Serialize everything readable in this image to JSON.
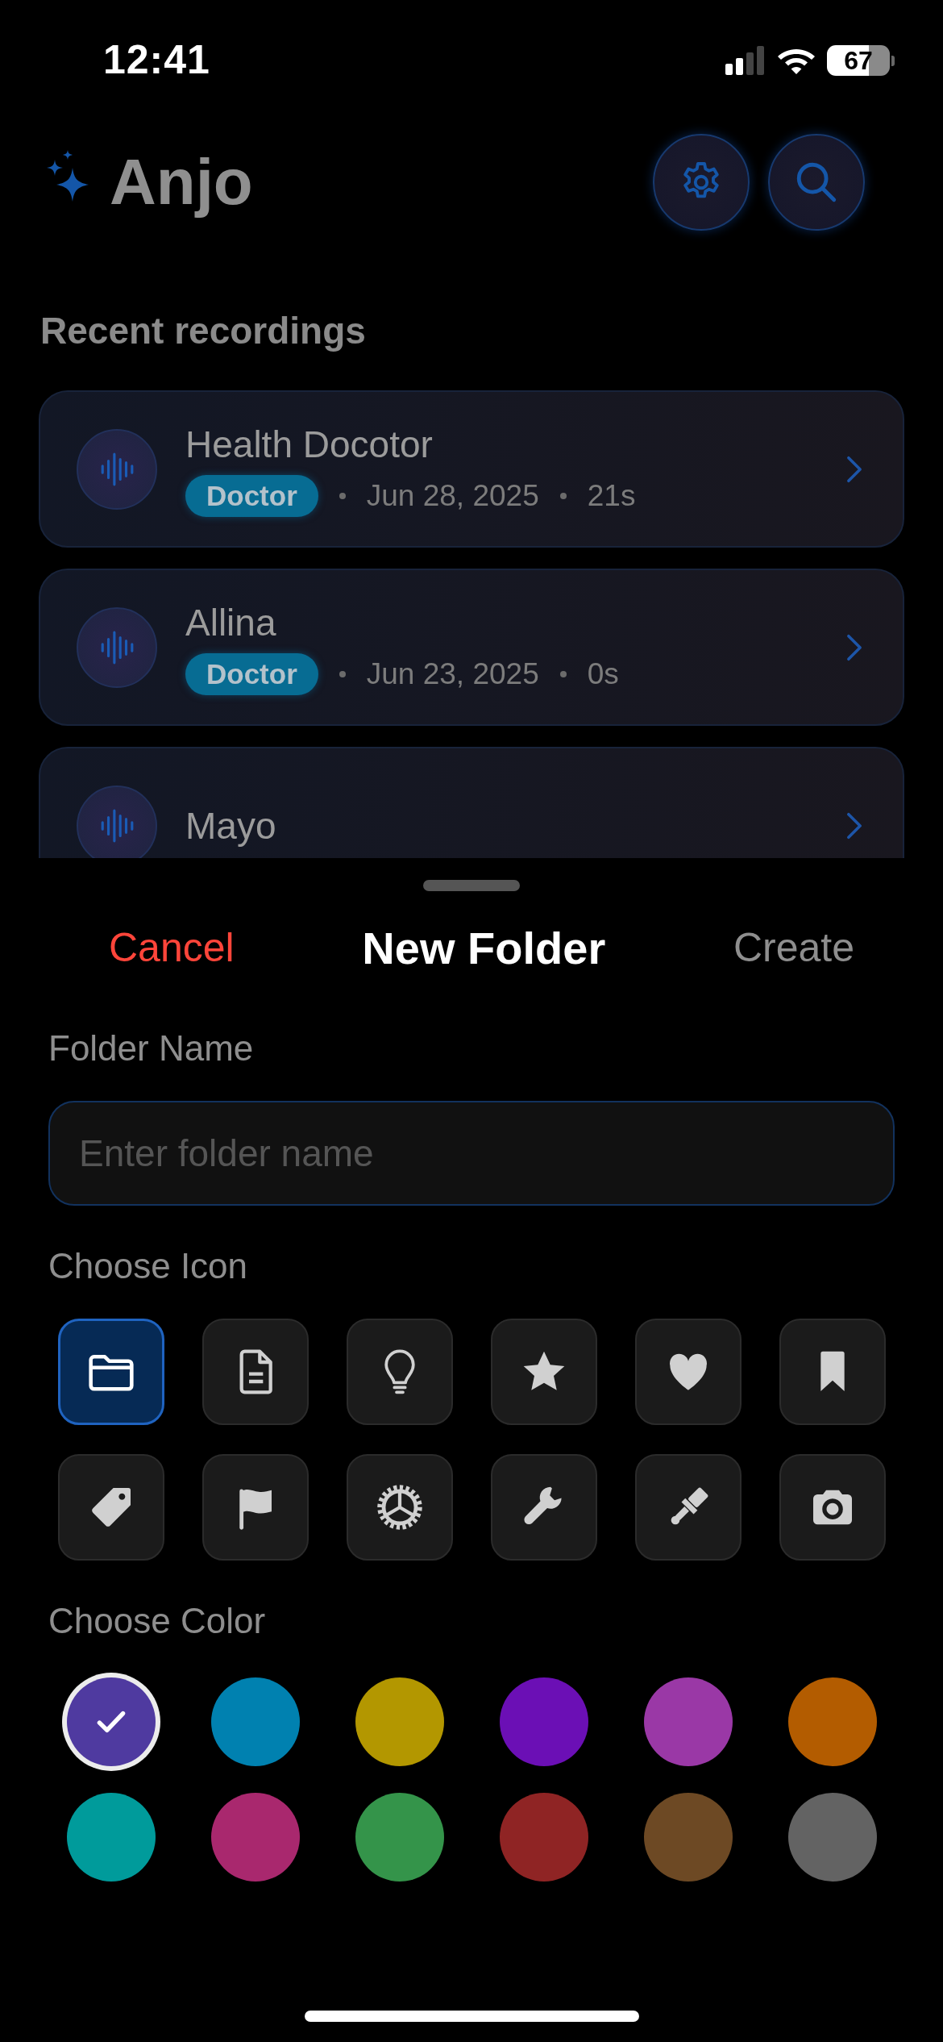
{
  "status_bar": {
    "time": "12:41",
    "battery": "67"
  },
  "header": {
    "title": "Anjo"
  },
  "section_title": "Recent recordings",
  "recordings": [
    {
      "title": "Health Docotor",
      "tag": "Doctor",
      "date": "Jun 28, 2025",
      "duration": "21s"
    },
    {
      "title": "Allina",
      "tag": "Doctor",
      "date": "Jun 23, 2025",
      "duration": "0s"
    },
    {
      "title": "Mayo"
    }
  ],
  "sheet": {
    "cancel": "Cancel",
    "title": "New Folder",
    "create": "Create",
    "name_label": "Folder Name",
    "name_field": {
      "placeholder": "Enter folder name"
    },
    "icon_label": "Choose Icon",
    "color_label": "Choose Color"
  },
  "icons": [
    {
      "selected": true
    },
    {
      "selected": false
    },
    {
      "selected": false
    },
    {
      "selected": false
    },
    {
      "selected": false
    },
    {
      "selected": false
    },
    {
      "selected": false
    },
    {
      "selected": false
    },
    {
      "selected": false
    },
    {
      "selected": false
    },
    {
      "selected": false
    },
    {
      "selected": false
    }
  ],
  "colors": [
    {
      "color": "#4f3aa0",
      "selected": true
    },
    {
      "color": "#0081b0",
      "selected": false
    },
    {
      "color": "#b39700",
      "selected": false
    },
    {
      "color": "#6b0fb5",
      "selected": false
    },
    {
      "color": "#9a38a6",
      "selected": false
    },
    {
      "color": "#b35c00",
      "selected": false
    },
    {
      "color": "#009b9b",
      "selected": false
    },
    {
      "color": "#a9286e",
      "selected": false
    },
    {
      "color": "#34944a",
      "selected": false
    },
    {
      "color": "#8f2424",
      "selected": false
    },
    {
      "color": "#6d4924",
      "selected": false
    },
    {
      "color": "#636363",
      "selected": false
    }
  ]
}
